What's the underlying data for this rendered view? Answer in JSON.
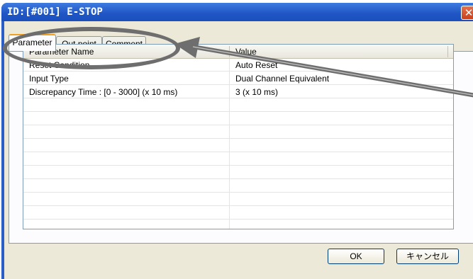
{
  "window": {
    "title": "ID:[#001] E-STOP",
    "close_glyph": "✕"
  },
  "tabs": [
    {
      "label": "Parameter",
      "active": true
    },
    {
      "label": "Out point",
      "active": false
    },
    {
      "label": "Comment",
      "active": false
    }
  ],
  "grid": {
    "columns": [
      "Parameter Name",
      "Value"
    ],
    "rows": [
      {
        "name": "Reset Condition",
        "value": "Auto Reset"
      },
      {
        "name": "Input Type",
        "value": "Dual Channel Equivalent"
      },
      {
        "name": "Discrepancy Time : [0 - 3000] (x 10 ms)",
        "value": "3 (x 10 ms)"
      }
    ],
    "empty_row_count": 9
  },
  "buttons": {
    "ok_label": "OK",
    "cancel_label": "キャンセル"
  },
  "colors": {
    "title_bar": "#2a5fc8",
    "callout": "#6e6e6e"
  },
  "annotation": {
    "icon": "callout-arrow-icon"
  }
}
